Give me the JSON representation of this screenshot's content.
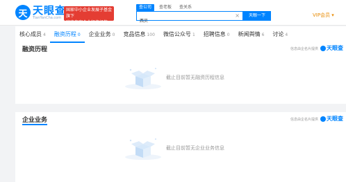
{
  "header": {
    "logo": {
      "mark": "天",
      "cn": "天眼查",
      "en": "TianYanCha.com"
    },
    "promo": {
      "line1": "国家中小企业发展子基金旗下",
      "line2": "官方备案企业征信机构"
    },
    "search_tabs": [
      "查公司",
      "查老板",
      "查关系"
    ],
    "search_value": "西贝",
    "search_button": "天眼一下",
    "vip": "VIP会员 ▾"
  },
  "tabs": [
    {
      "label": "核心成员",
      "count": "4"
    },
    {
      "label": "融资历程",
      "count": "0"
    },
    {
      "label": "企业业务",
      "count": "0"
    },
    {
      "label": "竞品信息",
      "count": "100"
    },
    {
      "label": "微信公众号",
      "count": "1"
    },
    {
      "label": "招聘信息",
      "count": "0"
    },
    {
      "label": "新闻舆情",
      "count": "6"
    },
    {
      "label": "讨论",
      "count": "4"
    }
  ],
  "sections": [
    {
      "title": "融资历程",
      "provider": "信息由企名片提供",
      "provider_logo": "天眼查",
      "empty_text": "截止目前暂无融资历程信息"
    },
    {
      "title": "企业业务",
      "provider": "信息由企名片提供",
      "provider_logo": "天眼查",
      "empty_text": "截止目前暂无企业业务信息"
    }
  ],
  "colors": {
    "brand": "#0084ff",
    "promo": "#e43d33",
    "vip": "#e88a00"
  }
}
